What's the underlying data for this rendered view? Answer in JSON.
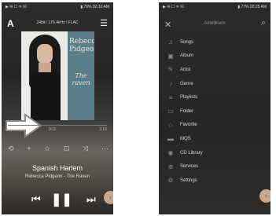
{
  "left_screen": {
    "status_left": "▶ ✉ ☐ ✕ ☒",
    "status_right": "▮ 76% 02:16 AM",
    "app_letter": "A",
    "format_info": "24bit / 176.4kHz / FLAC",
    "album_art": {
      "artist_text": "Rebecca Pidgeon",
      "title_text": "The raven"
    },
    "time_elapsed": "0:11",
    "time_total": "3:16",
    "song_title": "Spanish Harlem",
    "artist_album": "Rebecca Pidgeon - The Raven",
    "icons": [
      "repeat-icon",
      "add-icon",
      "favorite-star-icon",
      "queue-icon",
      "shuffle-icon",
      "more-icon"
    ],
    "icon_glyphs": [
      "⟲",
      "+",
      "☆",
      "⊡",
      "⤨",
      "···"
    ],
    "prev_glyph": "⏮",
    "pause_glyph": "❚❚",
    "next_glyph": "⏭",
    "fab_glyph": "‹"
  },
  "right_screen": {
    "status_left": "▶ ✉ ☐ ✕ ☒",
    "status_right": "▮ 77% 02:25 AM",
    "close_glyph": "✕",
    "title": "AstellKern",
    "search_glyph": "⌕",
    "menu_items": [
      {
        "label": "Songs",
        "icon": "music-note-icon",
        "glyph": "♫"
      },
      {
        "label": "Album",
        "icon": "album-icon",
        "glyph": "▣"
      },
      {
        "label": "Artist",
        "icon": "artist-icon",
        "glyph": "✎"
      },
      {
        "label": "Genre",
        "icon": "genre-icon",
        "glyph": "♪"
      },
      {
        "label": "Playlists",
        "icon": "playlist-icon",
        "glyph": "≡"
      },
      {
        "label": "Folder",
        "icon": "folder-icon",
        "glyph": "▭"
      },
      {
        "label": "Favorite",
        "icon": "favorite-star-icon",
        "glyph": "☆"
      },
      {
        "label": "MQS",
        "icon": "mqs-icon",
        "glyph": "▬"
      },
      {
        "label": "CD Library",
        "icon": "cd-library-icon",
        "glyph": "◉"
      },
      {
        "label": "Services",
        "icon": "services-icon",
        "glyph": "⊕"
      },
      {
        "label": "Settings",
        "icon": "settings-gear-icon",
        "glyph": "⚙"
      }
    ],
    "fab_glyph": "‹"
  },
  "colors": {
    "accent_fab": "#c9a98e",
    "arrow_outline": "#888888",
    "background_dark": "#262626"
  }
}
